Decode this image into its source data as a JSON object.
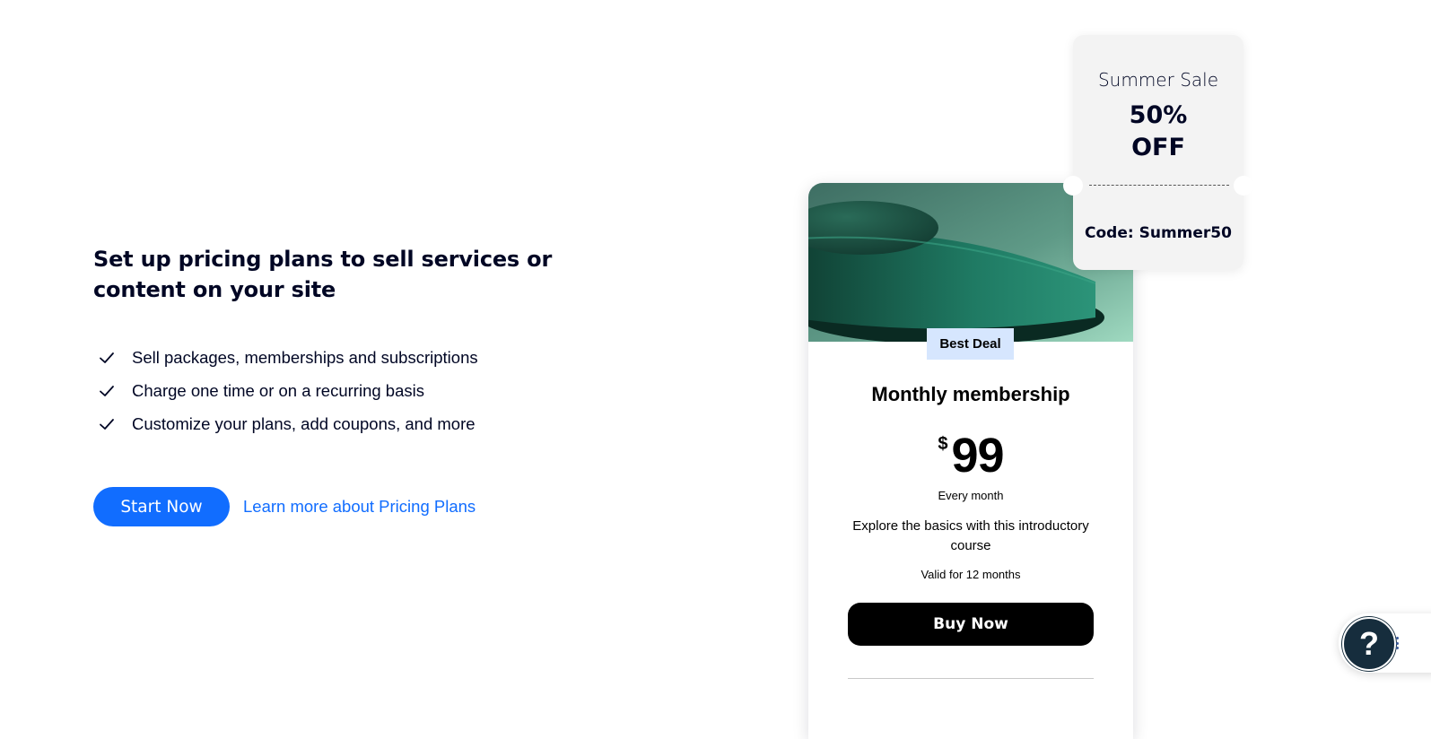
{
  "intro": {
    "headline": "Set up pricing plans to sell services or content on your site",
    "features": [
      {
        "label": "Sell packages, memberships and subscriptions",
        "icon": "check-icon"
      },
      {
        "label": "Charge one time or on a recurring basis",
        "icon": "check-icon"
      },
      {
        "label": "Customize your plans, add coupons, and more",
        "icon": "check-icon"
      }
    ],
    "start_button": "Start Now",
    "learn_link": "Learn more about Pricing Plans"
  },
  "plan_card": {
    "badge": "Best Deal",
    "name": "Monthly membership",
    "currency": "$",
    "price": "99",
    "period": "Every month",
    "description": "Explore the basics with this introductory course",
    "validity": "Valid for 12 months",
    "buy_button": "Buy Now"
  },
  "coupon": {
    "title": "Summer Sale",
    "discount_line1": "50%",
    "discount_line2": "OFF",
    "code": "Code: Summer50"
  },
  "help": {
    "icon": "question-icon",
    "label": "?"
  },
  "colors": {
    "accent": "#116dff",
    "text": "#000624",
    "badge_bg": "#d6e6fe",
    "buy_button_bg": "#000000",
    "coupon_bg": "#f3f3f3",
    "help_bg": "#162d3d"
  }
}
